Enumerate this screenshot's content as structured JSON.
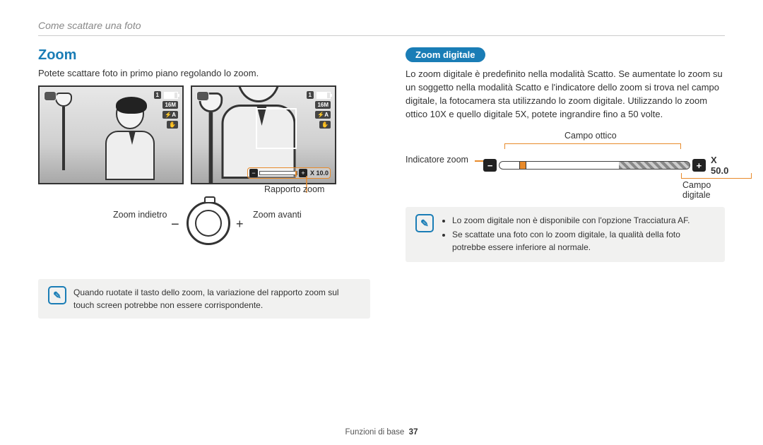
{
  "header": {
    "title": "Come scattare una foto"
  },
  "left": {
    "section_title": "Zoom",
    "intro": "Potete scattare foto in primo piano regolando lo zoom.",
    "screen_badges": {
      "counter": "1",
      "res": "16M",
      "zoom_ratio": "X 10.0"
    },
    "labels": {
      "rapporto": "Rapporto zoom",
      "indietro": "Zoom indietro",
      "avanti": "Zoom avanti"
    },
    "note": "Quando ruotate il tasto dello zoom, la variazione del rapporto zoom sul touch screen potrebbe non essere corrispondente."
  },
  "right": {
    "pill": "Zoom digitale",
    "para": "Lo zoom digitale è predefinito nella modalità Scatto. Se aumentate lo zoom su un soggetto nella modalità Scatto e l'indicatore dello zoom si trova nel campo digitale, la fotocamera sta utilizzando lo zoom digitale. Utilizzando lo zoom ottico 10X e quello digitale 5X, potete ingrandire fino a 50 volte.",
    "labels": {
      "campo_ottico": "Campo ottico",
      "indicatore": "Indicatore zoom",
      "campo_digitale": "Campo digitale",
      "value": "X 50.0"
    },
    "notes": [
      "Lo zoom digitale non è disponibile con l'opzione Tracciatura AF.",
      "Se scattate una foto con lo zoom digitale, la qualità della foto potrebbe essere inferiore al normale."
    ]
  },
  "footer": {
    "section": "Funzioni di base",
    "page": "37"
  }
}
